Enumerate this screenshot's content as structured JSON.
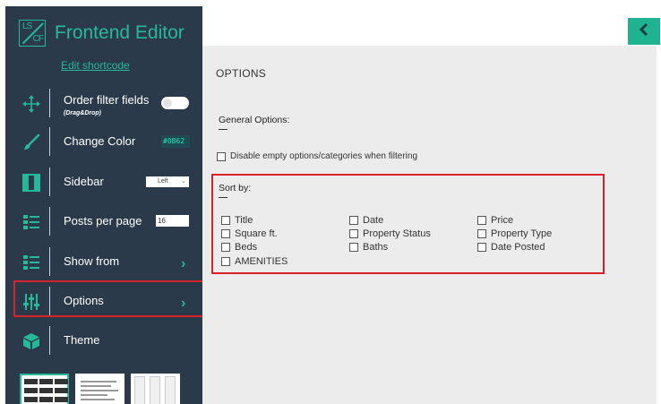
{
  "app": {
    "title": "Frontend Editor",
    "logo_top": "LS",
    "logo_bottom": "CF",
    "edit_link": "Edit shortcode"
  },
  "sidebar": {
    "items": [
      {
        "label": "Order filter fields",
        "sublabel": "(Drag&Drop)",
        "icon": "move-arrows-icon",
        "control": "toggle",
        "value": "off"
      },
      {
        "label": "Change Color",
        "icon": "brush-icon",
        "control": "color",
        "value": "#0B62"
      },
      {
        "label": "Sidebar",
        "icon": "columns-icon",
        "control": "select",
        "value": "Left"
      },
      {
        "label": "Posts per page",
        "icon": "list-icon",
        "control": "number",
        "value": "16"
      },
      {
        "label": "Show from",
        "icon": "list-icon",
        "control": "chevron"
      },
      {
        "label": "Options",
        "icon": "sliders-icon",
        "control": "chevron",
        "highlighted": true
      },
      {
        "label": "Theme",
        "icon": "cube-icon",
        "control": "none"
      }
    ]
  },
  "main": {
    "title": "OPTIONS",
    "general_title": "General Options:",
    "disable_empty_label": "Disable empty options/categories when filtering",
    "sort_title": "Sort by:",
    "sort_options": [
      [
        "Title",
        "Date",
        "Price"
      ],
      [
        "Square ft.",
        "Property Status",
        "Property Type"
      ],
      [
        "Beds",
        "Baths",
        "Date Posted"
      ],
      [
        "AMENITIES"
      ]
    ]
  },
  "colors": {
    "sidebar_bg": "#2b3a4a",
    "accent": "#27b89a",
    "highlight": "#d9232a",
    "panel_bg": "#ececec"
  }
}
